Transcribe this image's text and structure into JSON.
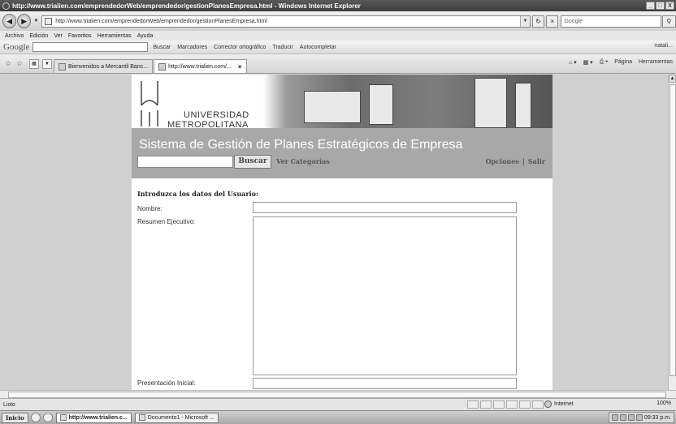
{
  "window": {
    "title": "http://www.trialien.com/emprendedorWeb/emprendedor/gestionPlanesEmpresa.html - Windows Internet Explorer",
    "buttons": [
      "_",
      "□",
      "X"
    ]
  },
  "address": {
    "url": "http://www.trialien.com/emprendedorWeb/emprendedor/gestionPlanesEmpresa.html",
    "search_placeholder": "Google"
  },
  "menu": [
    "Archivo",
    "Edición",
    "Ver",
    "Favoritos",
    "Herramientas",
    "Ayuda"
  ],
  "google_toolbar": {
    "logo": "Google",
    "items": [
      "Buscar",
      "Marcadores",
      "Corrector ortográfico",
      "Traducir",
      "Autocompletar"
    ],
    "user": "natali..."
  },
  "tabs": [
    {
      "label": "Bienvenidos a Mercantil Banc...",
      "active": false
    },
    {
      "label": "http://www.trialien.com/...",
      "active": true
    }
  ],
  "command_bar": [
    "Página",
    "Herramientas"
  ],
  "page": {
    "university_line1": "UNIVERSIDAD",
    "university_line2": "METROPOLITANA",
    "system_title": "Sistema de Gestión de Planes Estratégicos de Empresa",
    "search_button": "Buscar",
    "categories_link": "Ver Categorías",
    "options_link": "Opciones",
    "separator": "|",
    "logout_link": "Salir",
    "form_title": "Introduzca los datos del Usuario:",
    "fields": {
      "name_label": "Nombre:",
      "summary_label": "Resumen Ejecutivo:",
      "presentation_label": "Presentación Inicial:"
    }
  },
  "status": {
    "text": "Listo",
    "zone": "Internet",
    "zoom": "100%"
  },
  "taskbar": {
    "start": "Inicio",
    "items": [
      "http://www.trialien.c...",
      "Documento1 - Microsoft ..."
    ],
    "clock": "09:33 p.m."
  }
}
